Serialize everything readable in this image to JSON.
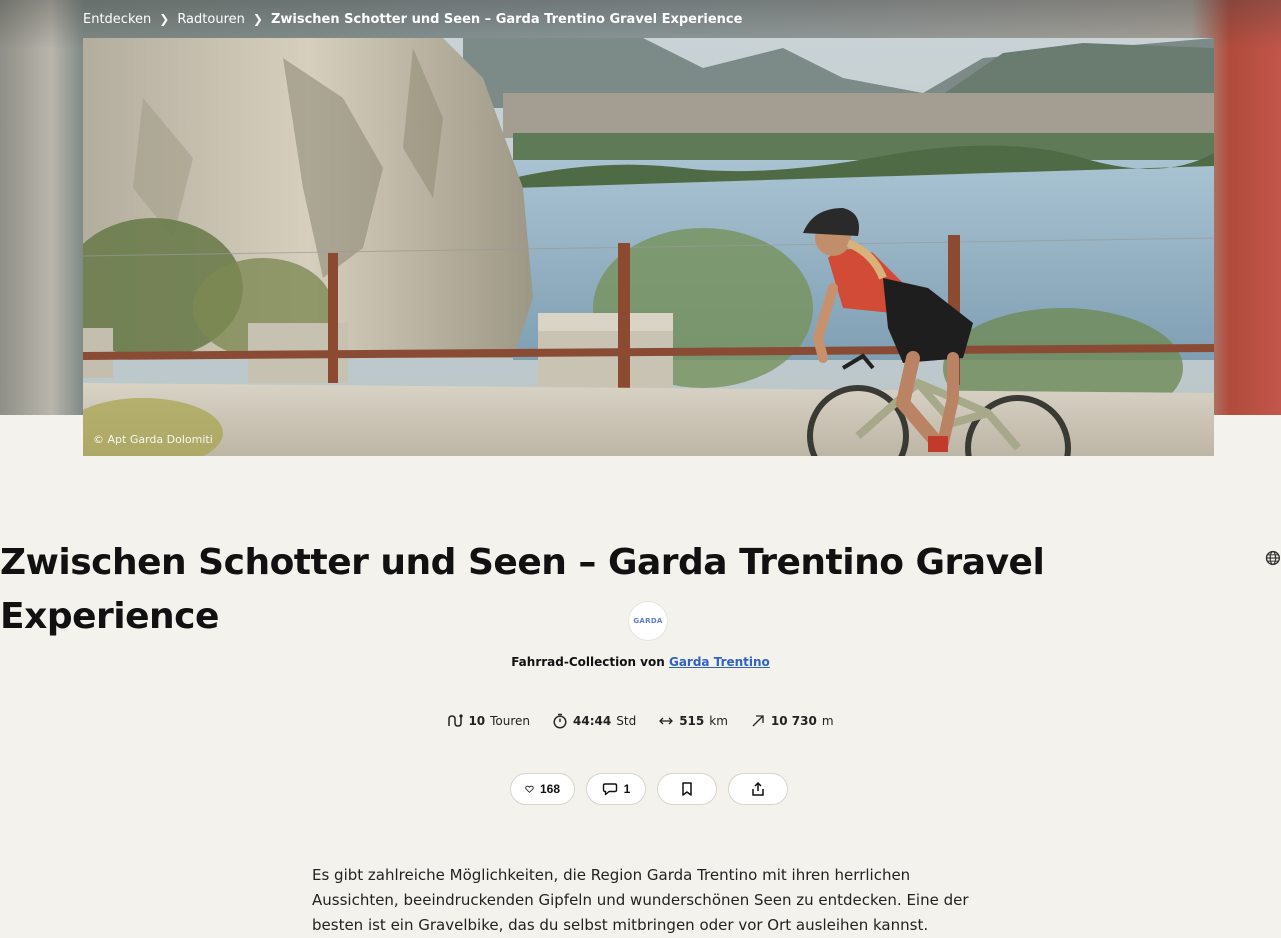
{
  "breadcrumb": {
    "items": [
      "Entdecken",
      "Radtouren"
    ],
    "current": "Zwischen Schotter und Seen – Garda Trentino Gravel Experience"
  },
  "hero": {
    "photo_credit": "© Apt Garda Dolomiti"
  },
  "collection": {
    "title": "Zwischen Schotter und Seen – Garda Trentino Gravel Experience",
    "owner_prefix": "Fahrrad-Collection von",
    "owner_name": "Garda Trentino",
    "avatar_text": "GARDA"
  },
  "stats": {
    "tours_value": "10",
    "tours_unit": "Touren",
    "duration_value": "44:44",
    "duration_unit": "Std",
    "distance_value": "515",
    "distance_unit": "km",
    "elevation_value": "10 730",
    "elevation_unit": "m"
  },
  "actions": {
    "likes": "168",
    "comments": "1"
  },
  "description": "Es gibt zahlreiche Möglichkeiten, die Region Garda Trentino mit ihren herrlichen Aussichten, beeindruckenden Gipfeln und wunderschönen Seen zu entdecken. Eine der besten ist ein Gravelbike, das du selbst mitbringen oder vor Ort ausleihen kannst.",
  "colors": {
    "background": "#f3f2ec",
    "link": "#2f63c4"
  }
}
